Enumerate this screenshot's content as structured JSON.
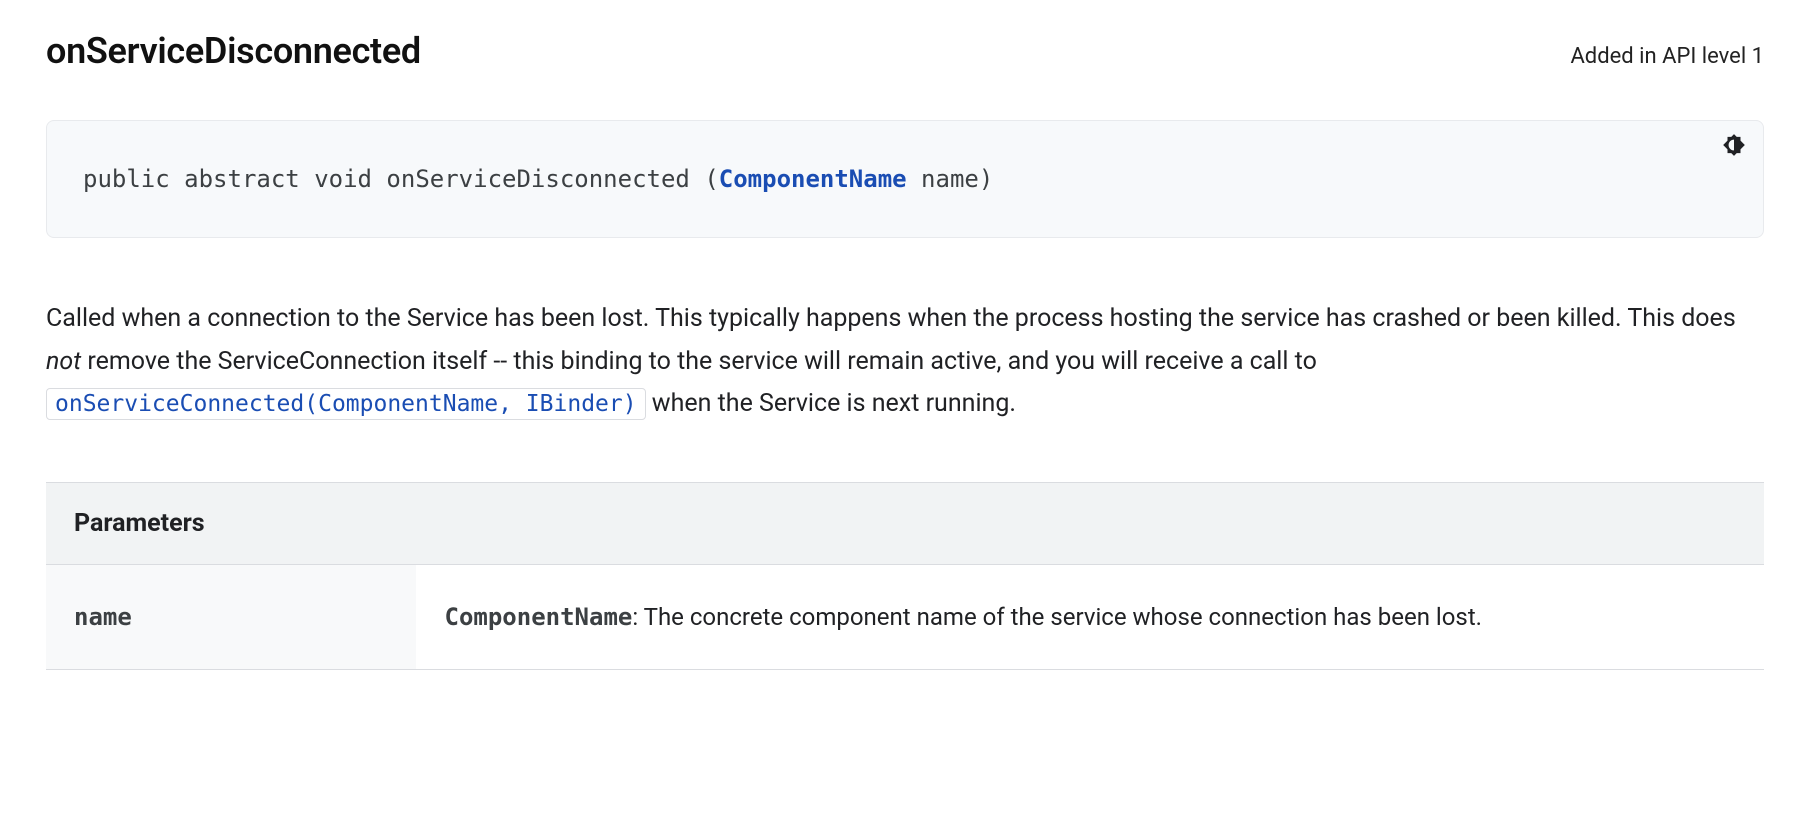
{
  "header": {
    "title": "onServiceDisconnected",
    "api_level": "Added in API level 1"
  },
  "codeblock": {
    "prefix": "public abstract void onServiceDisconnected (",
    "type_link": "ComponentName",
    "suffix": " name)"
  },
  "description": {
    "pre": "Called when a connection to the Service has been lost. This typically happens when the process hosting the service has crashed or been killed. This does ",
    "emph": "not",
    "mid": " remove the ServiceConnection itself -- this binding to the service will remain active, and you will receive a call to ",
    "inline_code": "onServiceConnected(ComponentName, IBinder)",
    "post": " when the Service is next running."
  },
  "parameters": {
    "heading": "Parameters",
    "rows": [
      {
        "name": "name",
        "type": "ComponentName",
        "desc": ": The concrete component name of the service whose connection has been lost."
      }
    ]
  }
}
